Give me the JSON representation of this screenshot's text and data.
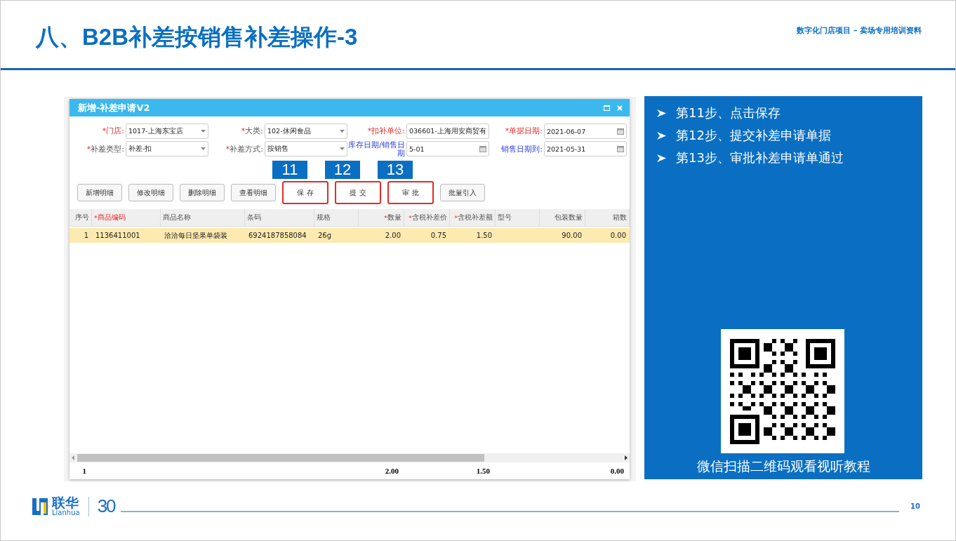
{
  "slide_title": "八、B2B补差按销售补差操作-3",
  "subtitle": "数字化门店项目 – 卖场专用培训资料",
  "dialog": {
    "title": "新增-补差申请V2",
    "fields": [
      {
        "mark": "*",
        "label": "门店:",
        "emphasized": true,
        "link": false,
        "kind": "select",
        "value": "1017-上海东宝店"
      },
      {
        "mark": "*",
        "label": "大类:",
        "emphasized": false,
        "link": false,
        "kind": "select",
        "value": "102-休闲食品"
      },
      {
        "mark": "*",
        "label": "扣补单位:",
        "emphasized": true,
        "link": false,
        "kind": "select",
        "value": "036601-上海用安商贸有"
      },
      {
        "mark": "*",
        "label": "单据日期:",
        "emphasized": true,
        "link": false,
        "kind": "date",
        "value": "2021-06-07"
      },
      {
        "mark": "*",
        "label": "补差类型:",
        "emphasized": false,
        "link": false,
        "kind": "select",
        "value": "补差-扣"
      },
      {
        "mark": "*",
        "label": "补差方式:",
        "emphasized": false,
        "link": false,
        "kind": "select",
        "value": "按销售"
      },
      {
        "label": "库存日期/销售日期",
        "emphasized": false,
        "link": true,
        "kind": "date",
        "value": "5-01"
      },
      {
        "label": "销售日期到:",
        "emphasized": false,
        "link": true,
        "kind": "date",
        "value": "2021-05-31"
      }
    ],
    "buttons": [
      {
        "label": "新增明细",
        "highlighted": false
      },
      {
        "label": "修改明细",
        "highlighted": false
      },
      {
        "label": "删除明细",
        "highlighted": false
      },
      {
        "label": "查看明细",
        "highlighted": false
      },
      {
        "label": "保 存",
        "highlighted": true,
        "callout": "11"
      },
      {
        "label": "提 交",
        "highlighted": true,
        "callout": "12"
      },
      {
        "label": "审 批",
        "highlighted": true,
        "callout": "13"
      },
      {
        "label": "批量引入",
        "highlighted": false
      }
    ],
    "table": {
      "columns": [
        {
          "label": "序号",
          "kind": "number"
        },
        {
          "mark": "*",
          "label": "商品编码",
          "kind": "code"
        },
        {
          "label": "商品名称",
          "kind": "text"
        },
        {
          "label": "条码",
          "kind": "text"
        },
        {
          "label": "规格",
          "kind": "text"
        },
        {
          "mark": "*",
          "label": "数量",
          "kind": "number"
        },
        {
          "mark": "*",
          "label": "含税补差价",
          "kind": "number"
        },
        {
          "mark": "*",
          "label": "含税补差额",
          "kind": "number"
        },
        {
          "label": "型号",
          "kind": "text"
        },
        {
          "label": "包装数量",
          "kind": "number"
        },
        {
          "label": "箱数",
          "kind": "number"
        }
      ],
      "rows": [
        {
          "selected": true,
          "cells": [
            "1",
            "1136411001",
            "洽洽每日坚果单袋装",
            "6924187858084",
            "26g",
            "2.00",
            "0.75",
            "1.50",
            null,
            "90.00",
            "0.00"
          ]
        }
      ],
      "totals": {
        "column_1": "1",
        "column_6": "2.00",
        "column_8": "1.50",
        "column_11": "0.00"
      }
    }
  },
  "steps": [
    "第11步、点击保存",
    "第12步、提交补差申请单据",
    "第13步、审批补差申请单通过"
  ],
  "qr_caption": "微信扫描二维码观看视听教程",
  "footer": {
    "brand": "联华",
    "brand_latin": "Lianhua",
    "anniversary": "30",
    "page_number": "10"
  }
}
